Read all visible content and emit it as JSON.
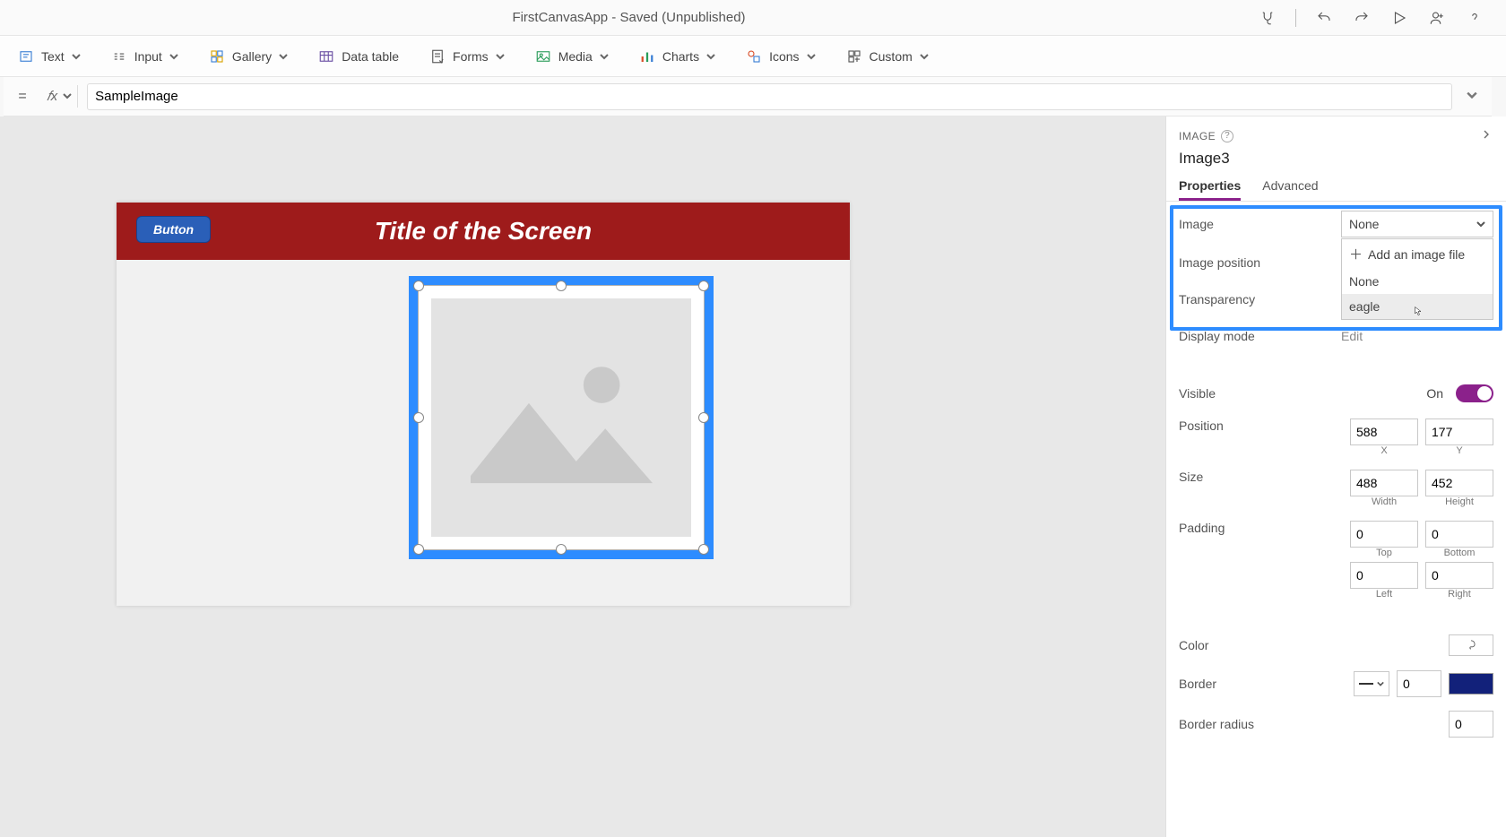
{
  "header": {
    "app_title": "FirstCanvasApp - Saved (Unpublished)"
  },
  "ribbon": {
    "text": "Text",
    "input": "Input",
    "gallery": "Gallery",
    "data_table": "Data table",
    "forms": "Forms",
    "media": "Media",
    "charts": "Charts",
    "icons": "Icons",
    "custom": "Custom"
  },
  "formula": {
    "value": "SampleImage"
  },
  "canvas": {
    "button_label": "Button",
    "screen_title": "Title of the Screen"
  },
  "panel": {
    "section": "IMAGE",
    "control_name": "Image3",
    "tabs": {
      "properties": "Properties",
      "advanced": "Advanced"
    },
    "image": {
      "label": "Image",
      "value": "None",
      "dropdown": {
        "add": "Add an image file",
        "none": "None",
        "eagle": "eagle"
      }
    },
    "image_position": {
      "label": "Image position"
    },
    "transparency": {
      "label": "Transparency"
    },
    "display_mode": {
      "label": "Display mode",
      "value": "Edit"
    },
    "visible": {
      "label": "Visible",
      "state": "On"
    },
    "position": {
      "label": "Position",
      "x": "588",
      "y": "177",
      "xlabel": "X",
      "ylabel": "Y"
    },
    "size": {
      "label": "Size",
      "w": "488",
      "h": "452",
      "wlabel": "Width",
      "hlabel": "Height"
    },
    "padding": {
      "label": "Padding",
      "top": "0",
      "bottom": "0",
      "left": "0",
      "right": "0",
      "tlabel": "Top",
      "blabel": "Bottom",
      "llabel": "Left",
      "rlabel": "Right"
    },
    "color": {
      "label": "Color"
    },
    "border": {
      "label": "Border",
      "value": "0"
    },
    "border_radius": {
      "label": "Border radius",
      "value": "0"
    }
  }
}
